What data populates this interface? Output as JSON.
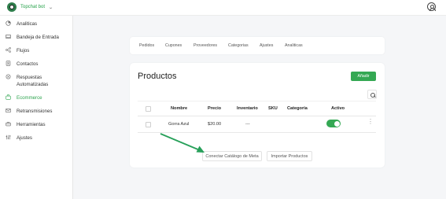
{
  "app": {
    "name": "Topchat bot",
    "accent_color": "#2ea44f"
  },
  "sidebar": {
    "items": [
      {
        "label": "Analiticas",
        "icon": "analytics-icon"
      },
      {
        "label": "Bandeja de Entrada",
        "icon": "inbox-icon"
      },
      {
        "label": "Flujos",
        "icon": "flows-icon"
      },
      {
        "label": "Contactos",
        "icon": "contacts-icon"
      },
      {
        "label": "Respuestas Automatizadas",
        "icon": "auto-reply-icon"
      },
      {
        "label": "Ecommerce",
        "icon": "ecommerce-icon",
        "active": true
      },
      {
        "label": "Retransmisiones",
        "icon": "broadcast-icon"
      },
      {
        "label": "Herramientas",
        "icon": "tools-icon"
      },
      {
        "label": "Ajustes",
        "icon": "settings-icon"
      }
    ]
  },
  "tabs": [
    "Pedidos",
    "Cupones",
    "Proveedores",
    "Categorias",
    "Ajustes",
    "Analiticas"
  ],
  "products": {
    "title": "Productos",
    "add_label": "Añadir",
    "columns": [
      "Nombre",
      "Precio",
      "Inventario",
      "SKU",
      "Categoría",
      "Activo"
    ],
    "rows": [
      {
        "name": "Gorra Azul",
        "price": "$20.00",
        "inventory": "---",
        "sku": "",
        "category": "",
        "active": true
      }
    ],
    "connect_catalog_label": "Conectar Catálogo de Meta",
    "import_label": "Importar Productos"
  }
}
